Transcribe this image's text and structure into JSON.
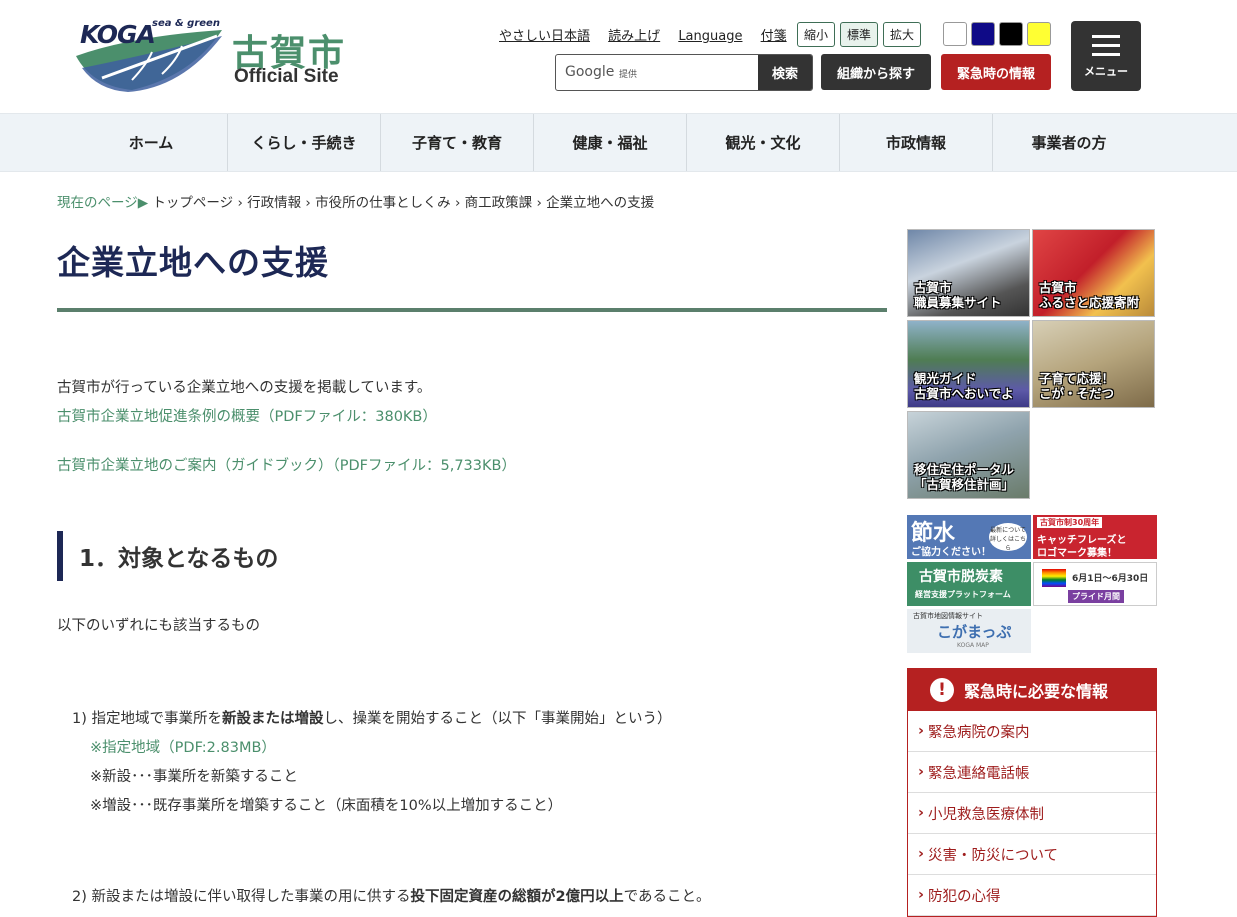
{
  "header": {
    "logo": {
      "koga": "KOGA",
      "tagline": "sea & green",
      "city": "古賀市",
      "official": "Official Site"
    },
    "util_links": [
      "やさしい日本語",
      "読み上げ",
      "Language",
      "付箋"
    ],
    "font_size": {
      "small": "縮小",
      "normal": "標準",
      "large": "拡大"
    },
    "color_themes": [
      "#ffffff",
      "#0f0a87",
      "#000000",
      "#ffff33"
    ],
    "search": {
      "brand": "Google",
      "provided": "提供",
      "button": "検索"
    },
    "org_button": "組織から探す",
    "emergency_button": "緊急時の情報",
    "menu_button": "メニュー"
  },
  "nav": [
    "ホーム",
    "くらし・手続き",
    "子育て・教育",
    "健康・福祉",
    "観光・文化",
    "市政情報",
    "事業者の方"
  ],
  "breadcrumb": {
    "here_label": "現在のページ▶",
    "items": [
      "トップページ",
      "行政情報",
      "市役所の仕事としくみ",
      "商工政策課",
      "企業立地への支援"
    ]
  },
  "main": {
    "title": "企業立地への支援",
    "intro": "古賀市が行っている企業立地への支援を掲載しています。",
    "link1": "古賀市企業立地促進条例の概要（PDFファイル：380KB）",
    "link2": "古賀市企業立地のご案内（ガイドブック）（PDFファイル：5,733KB）",
    "section1": "1．対象となるもの",
    "section1_desc": "以下のいずれにも該当するもの",
    "item1": {
      "a": "1) 指定地域で事業所を",
      "b": "新設または増設",
      "c": "し、操業を開始すること（以下「事業開始」という）"
    },
    "note1_prefix": "※",
    "note1_link": "指定地域（PDF:2.83MB）",
    "note2": "※新設･･･事業所を新築すること",
    "note3": "※増設･･･既存事業所を増築すること（床面積を10%以上増加すること）",
    "item2": {
      "a": "2) 新設または増設に伴い取得した事業の用に供する",
      "b": "投下固定資産の総額が2億円以上",
      "c": "であること。"
    }
  },
  "side": {
    "banners": [
      {
        "l1": "古賀市",
        "l2": "職員募集サイト"
      },
      {
        "l1": "古賀市",
        "l2": "ふるさと応援寄附"
      },
      {
        "l1": "観光ガイド",
        "l2": "古賀市へおいでよ"
      },
      {
        "l1": "子育て応援！",
        "l2": "こが・そだつ"
      },
      {
        "l1": "移住定住ポータル",
        "l2": "「古賀移住計画」"
      }
    ],
    "small_banners": {
      "water": {
        "main": "節水",
        "sub": "ご協力ください！",
        "bubble": "最新について詳しくはこちら"
      },
      "anniv": {
        "top": "古賀市制30周年",
        "l1": "キャッチフレーズと",
        "l2": "ロゴマーク募集！"
      },
      "decarb": {
        "main": "古賀市脱炭素",
        "sub": "経営支援プラットフォーム"
      },
      "pride": {
        "dates": "6月1日～6月30日",
        "label": "プライド月間"
      },
      "map": {
        "top": "古賀市地図情報サイト",
        "name": "こがまっぷ",
        "sub": "KOGA MAP"
      }
    },
    "emergency": {
      "title": "緊急時に必要な情報",
      "items": [
        "緊急病院の案内",
        "緊急連絡電話帳",
        "小児救急医療体制",
        "災害・防災について",
        "防犯の心得"
      ]
    }
  }
}
